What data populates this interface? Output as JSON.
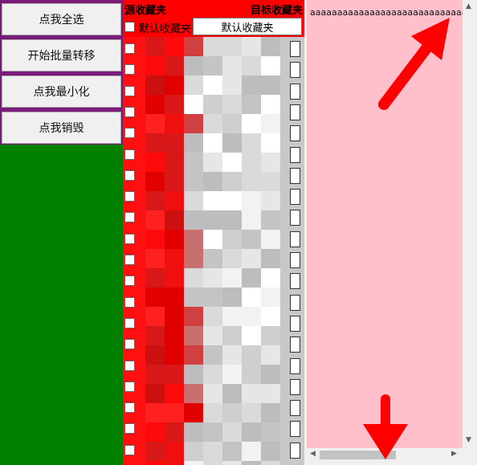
{
  "colors": {
    "accent_red": "#ff0000",
    "green_panel": "#008000",
    "pink_panel": "#ffc0cb",
    "left_border": "#7a1b7a"
  },
  "buttons": {
    "select_all": "点我全选",
    "batch_move": "开始批量转移",
    "minimize": "点我最小化",
    "destroy": "点我销毁"
  },
  "source": {
    "title": "源收藏夹",
    "default_label": "默认收藏夹"
  },
  "target": {
    "title": "目标收藏夹",
    "default_button": "默认收藏夹"
  },
  "output": {
    "text": "aaaaaaaaaaaaaaaaaaaaaaaaaaaaa"
  },
  "icons": {
    "scroll_up": "triangle-up",
    "scroll_down": "triangle-down",
    "scroll_left": "triangle-left",
    "scroll_right": "triangle-right"
  },
  "annotations": {
    "arrow_color": "#ff0000"
  }
}
